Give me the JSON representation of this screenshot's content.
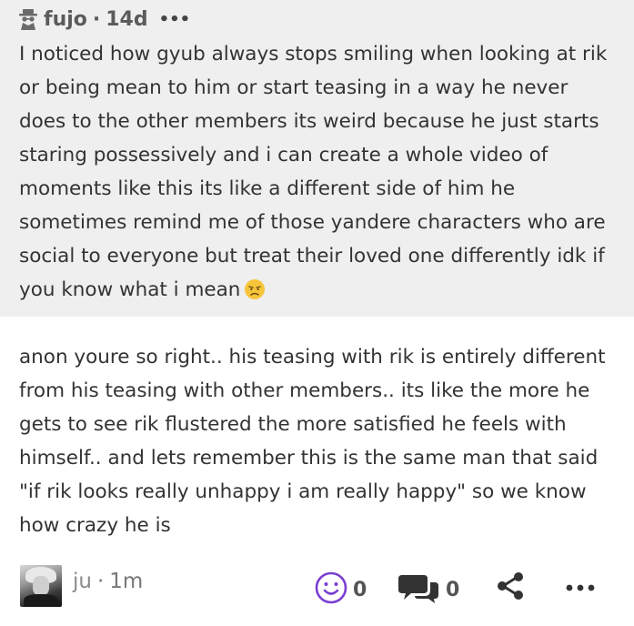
{
  "quoted_post": {
    "author": "fujo",
    "separator": "·",
    "time": "14d",
    "more_label": "•••",
    "text": "I noticed how gyub always stops smiling when looking at rik or being mean to him or start teasing in a way he never does to the other members its weird because he just starts staring possessively and i can create a whole video of moments like this its like a different side of him he sometimes remind me of those yandere characters who are social to everyone but treat their loved one differently idk if you know what i mean",
    "emoji": "disappointed-face"
  },
  "reply": {
    "text": "anon youre so right.. his teasing with rik is entirely different from his teasing with other members.. its like the more he gets to see rik flustered the more satisfied he feels with himself.. and lets remember this is the same man that said \"if rik looks really unhappy i am really happy\" so we know how crazy he is",
    "author": "ju",
    "separator": "·",
    "time": "1m",
    "reaction_count": "0",
    "comment_count": "0",
    "more_label": "•••"
  },
  "colors": {
    "quote_background": "#efefef",
    "accent_purple": "#7a3fd1",
    "icon_dark": "#333333"
  },
  "icons": {
    "author_icon": "spy-icon",
    "react_icon": "smile-icon",
    "comment_icon": "comment-bubbles-icon",
    "share_icon": "share-icon",
    "more_icon": "ellipsis-icon"
  }
}
